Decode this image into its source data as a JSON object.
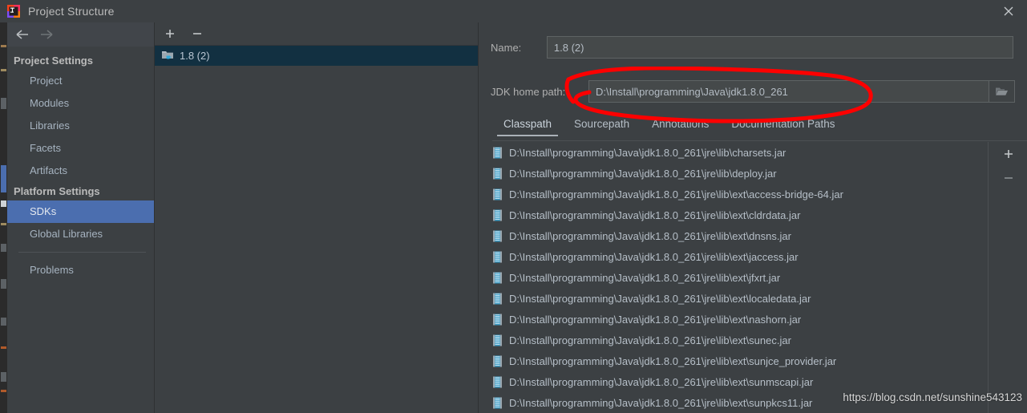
{
  "window": {
    "title": "Project Structure",
    "app_icon": "intellij-idea-icon",
    "close_icon": "close-icon"
  },
  "left_pane": {
    "nav": {
      "back_icon": "arrow-left-icon",
      "forward_icon": "arrow-right-icon"
    },
    "groups": [
      {
        "label": "Project Settings",
        "items": [
          {
            "label": "Project",
            "selected": false
          },
          {
            "label": "Modules",
            "selected": false
          },
          {
            "label": "Libraries",
            "selected": false
          },
          {
            "label": "Facets",
            "selected": false
          },
          {
            "label": "Artifacts",
            "selected": false
          }
        ]
      },
      {
        "label": "Platform Settings",
        "items": [
          {
            "label": "SDKs",
            "selected": true
          },
          {
            "label": "Global Libraries",
            "selected": false
          }
        ]
      }
    ],
    "extra_items": [
      {
        "label": "Problems",
        "selected": false
      }
    ]
  },
  "sdk_pane": {
    "toolbar": {
      "add_label": "+",
      "add_name": "add-sdk-button",
      "remove_label": "−",
      "remove_name": "remove-sdk-button"
    },
    "items": [
      {
        "label": "1.8 (2)",
        "icon": "java-sdk-folder-icon",
        "selected": true
      }
    ]
  },
  "detail_pane": {
    "name_label": "Name:",
    "name_value": "1.8 (2)",
    "jdk_path_label": "JDK home path:",
    "jdk_path_value": "D:\\Install\\programming\\Java\\jdk1.8.0_261",
    "browse_icon": "folder-open-icon",
    "tabs": [
      {
        "label": "Classpath",
        "active": true
      },
      {
        "label": "Sourcepath",
        "active": false
      },
      {
        "label": "Annotations",
        "active": false
      },
      {
        "label": "Documentation Paths",
        "active": false
      }
    ],
    "classpath_toolbar": {
      "add_label": "+",
      "add_name": "add-classpath-button",
      "remove_label": "−",
      "remove_name": "remove-classpath-button"
    },
    "classpath_entries": [
      "D:\\Install\\programming\\Java\\jdk1.8.0_261\\jre\\lib\\charsets.jar",
      "D:\\Install\\programming\\Java\\jdk1.8.0_261\\jre\\lib\\deploy.jar",
      "D:\\Install\\programming\\Java\\jdk1.8.0_261\\jre\\lib\\ext\\access-bridge-64.jar",
      "D:\\Install\\programming\\Java\\jdk1.8.0_261\\jre\\lib\\ext\\cldrdata.jar",
      "D:\\Install\\programming\\Java\\jdk1.8.0_261\\jre\\lib\\ext\\dnsns.jar",
      "D:\\Install\\programming\\Java\\jdk1.8.0_261\\jre\\lib\\ext\\jaccess.jar",
      "D:\\Install\\programming\\Java\\jdk1.8.0_261\\jre\\lib\\ext\\jfxrt.jar",
      "D:\\Install\\programming\\Java\\jdk1.8.0_261\\jre\\lib\\ext\\localedata.jar",
      "D:\\Install\\programming\\Java\\jdk1.8.0_261\\jre\\lib\\ext\\nashorn.jar",
      "D:\\Install\\programming\\Java\\jdk1.8.0_261\\jre\\lib\\ext\\sunec.jar",
      "D:\\Install\\programming\\Java\\jdk1.8.0_261\\jre\\lib\\ext\\sunjce_provider.jar",
      "D:\\Install\\programming\\Java\\jdk1.8.0_261\\jre\\lib\\ext\\sunmscapi.jar",
      "D:\\Install\\programming\\Java\\jdk1.8.0_261\\jre\\lib\\ext\\sunpkcs11.jar"
    ]
  },
  "annotation": {
    "shape": "red-hand-drawn-ellipse",
    "color": "#fe0000",
    "target": "jdk-home-path-field"
  },
  "watermark": {
    "text": "https://blog.csdn.net/sunshine543123"
  },
  "colors": {
    "window_bg": "#3c4043",
    "selection_blue": "#4b6eaf",
    "sdk_selection": "#123041",
    "field_bg": "#45494a",
    "text": "#a9b7c6",
    "annotation_red": "#fe0000"
  }
}
